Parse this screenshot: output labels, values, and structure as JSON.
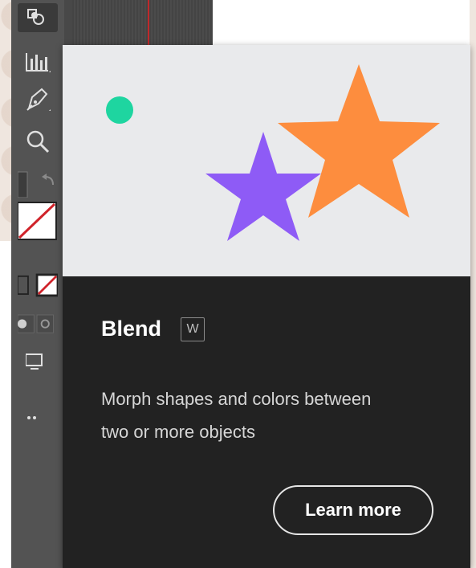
{
  "toolbar": {
    "tools": [
      {
        "icon": "shape-builder-icon"
      },
      {
        "icon": "column-graph-icon"
      },
      {
        "icon": "pen-icon"
      },
      {
        "icon": "zoom-icon"
      },
      {
        "icon": "swap-colors-icon"
      },
      {
        "icon": "stroke-swatch-icon"
      },
      {
        "icon": "none-color-icon"
      },
      {
        "icon": "draw-mode-icon"
      },
      {
        "icon": "screen-mode-icon"
      },
      {
        "icon": "more-tools-icon"
      }
    ]
  },
  "tooltip": {
    "title": "Blend",
    "shortcut": "W",
    "description_line1": "Morph shapes and colors between",
    "description_line2": "two or more objects",
    "button_label": "Learn more"
  },
  "colors": {
    "circle": "#1ed5a0",
    "star_purple": "#8e5bf6",
    "star_orange": "#fd8d3e",
    "card_bg": "#222222",
    "preview_bg": "#e9eaec"
  }
}
